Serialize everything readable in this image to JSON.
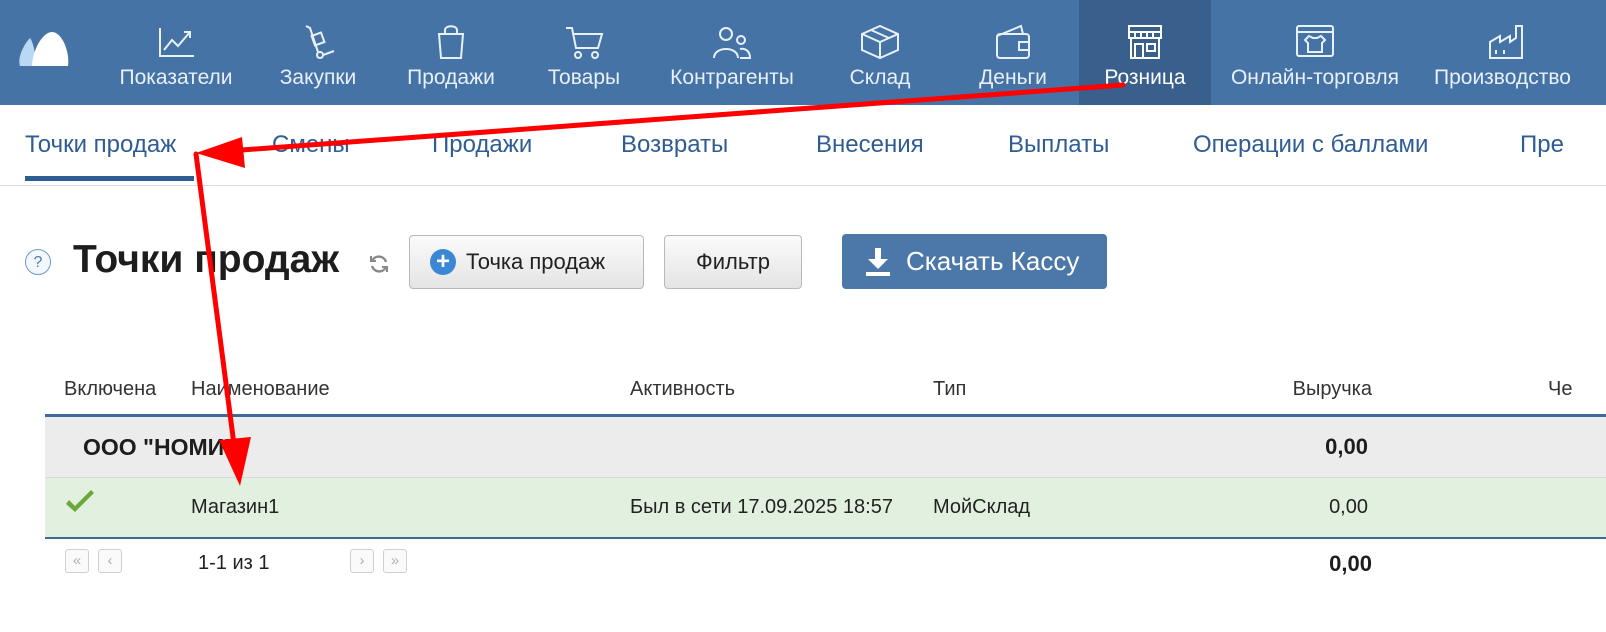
{
  "topnav": {
    "items": [
      {
        "label": "Показатели",
        "icon": "chart-line-icon"
      },
      {
        "label": "Закупки",
        "icon": "hand-truck-icon"
      },
      {
        "label": "Продажи",
        "icon": "shopping-bag-icon"
      },
      {
        "label": "Товары",
        "icon": "shopping-cart-icon"
      },
      {
        "label": "Контрагенты",
        "icon": "people-icon"
      },
      {
        "label": "Склад",
        "icon": "box-icon"
      },
      {
        "label": "Деньги",
        "icon": "wallet-icon"
      },
      {
        "label": "Розница",
        "icon": "storefront-icon",
        "active": true
      },
      {
        "label": "Онлайн-торговля",
        "icon": "online-shop-icon"
      },
      {
        "label": "Производство",
        "icon": "factory-icon"
      }
    ],
    "background": "#4673a5",
    "active_background": "#395f8c"
  },
  "subnav": {
    "tabs": [
      {
        "label": "Точки продаж",
        "active": true
      },
      {
        "label": "Смены"
      },
      {
        "label": "Продажи"
      },
      {
        "label": "Возвраты"
      },
      {
        "label": "Внесения"
      },
      {
        "label": "Выплаты"
      },
      {
        "label": "Операции с баллами"
      },
      {
        "label": "Пре"
      }
    ]
  },
  "page": {
    "help_label": "?",
    "title": "Точки продаж",
    "add_button": "Точка продаж",
    "filter_button": "Фильтр",
    "download_button": "Скачать Кассу"
  },
  "table": {
    "headers": {
      "enabled": "Включена",
      "name": "Наименование",
      "activity": "Активность",
      "type": "Тип",
      "revenue": "Выручка",
      "extra": "Че"
    },
    "group": {
      "name": "ООО \"НОМИ\"",
      "revenue": "0,00"
    },
    "rows": [
      {
        "enabled": true,
        "name": "Магазин1",
        "activity": "Был в сети 17.09.2025 18:57",
        "type": "МойСклад",
        "revenue": "0,00"
      }
    ],
    "pager": {
      "text": "1-1 из 1"
    },
    "total": "0,00",
    "row_color": "#e2f1df",
    "accent": "#3f6a9c"
  },
  "annotation": {
    "arrow_color": "#ff0000"
  }
}
